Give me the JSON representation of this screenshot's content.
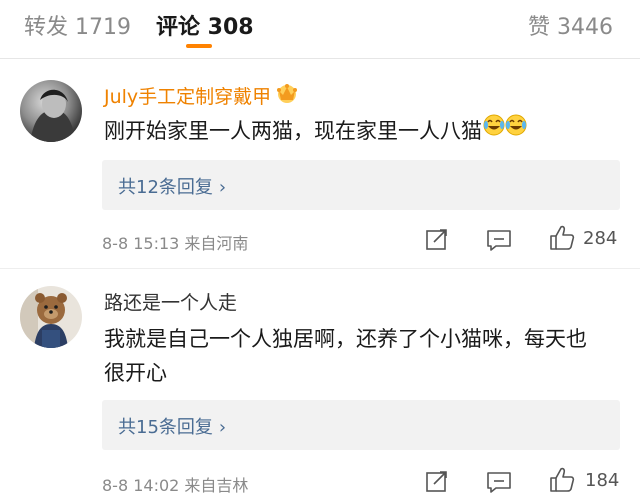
{
  "tabs": {
    "repost_label": "转发 1719",
    "comment_label": "评论 308",
    "like_label": "赞 3446"
  },
  "comments": [
    {
      "author": "July手工定制穿戴甲",
      "text": "刚开始家里一人两猫，现在家里一人八猫",
      "reply_label": "共12条回复",
      "meta": "8-8 15:13  来自河南",
      "likes": "284"
    },
    {
      "author": "路还是一个人走",
      "text": "我就是自己一个人独居啊，还养了个小猫咪，每天也很开心",
      "reply_label": "共15条回复",
      "meta": "8-8 14:02  来自吉林",
      "likes": "184"
    }
  ],
  "icons": {
    "crown": "vip-crown-icon",
    "laugh_cry": "laugh-cry-emoji-icon",
    "repost": "repost-icon",
    "comment": "comment-icon",
    "like": "thumbs-up-icon",
    "chevron": "chevron-right-icon"
  },
  "colors": {
    "accent": "#ff8200",
    "vip_name": "#ef8200",
    "link": "#4a6c93",
    "meta": "#8a8a8a"
  }
}
